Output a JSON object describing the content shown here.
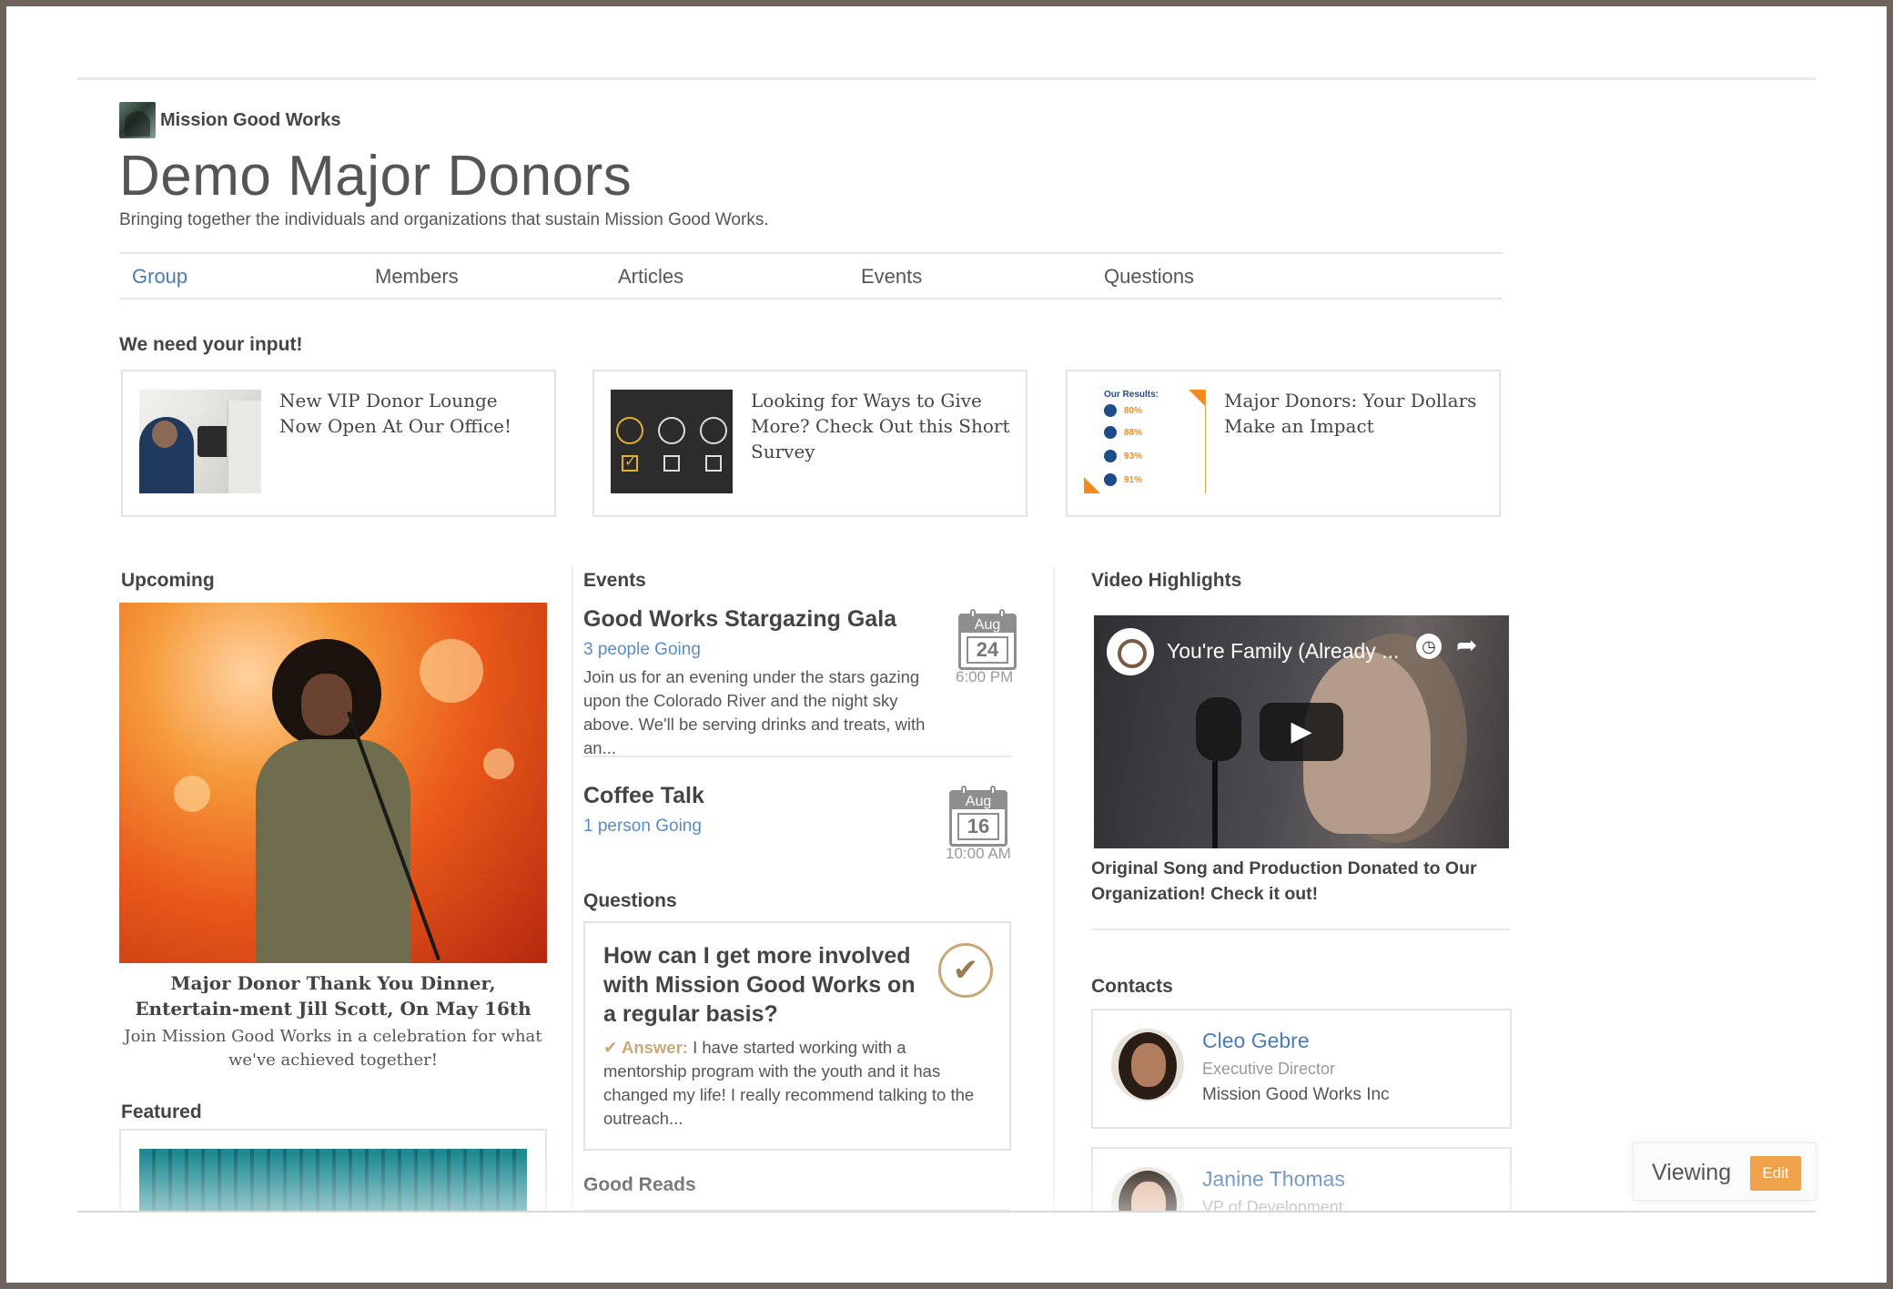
{
  "brand": {
    "name": "Mission Good Works"
  },
  "header": {
    "title": "Demo Major Donors",
    "subtitle": "Bringing together the individuals and organizations that sustain Mission Good Works."
  },
  "tabs": [
    {
      "label": "Group",
      "active": true
    },
    {
      "label": "Members",
      "active": false
    },
    {
      "label": "Articles",
      "active": false
    },
    {
      "label": "Events",
      "active": false
    },
    {
      "label": "Questions",
      "active": false
    }
  ],
  "input_section": {
    "heading": "We need your input!",
    "cards": [
      {
        "title": "New VIP Donor Lounge Now Open At Our Office!"
      },
      {
        "title": "Looking for Ways to Give More? Check Out this Short Survey"
      },
      {
        "title": "Major Donors: Your Dollars Make an Impact"
      }
    ],
    "infographic": {
      "heading": "Our Results:",
      "stats": [
        "80%",
        "88%",
        "93%",
        "91%"
      ]
    }
  },
  "upcoming": {
    "heading": "Upcoming",
    "caption": "Major Donor Thank You Dinner, Entertain-ment Jill Scott, On May 16th",
    "description": "Join Mission Good Works in a celebration for what we've achieved together!"
  },
  "featured": {
    "heading": "Featured"
  },
  "events": {
    "heading": "Events",
    "items": [
      {
        "title": "Good Works Stargazing Gala",
        "going": "3 people Going",
        "description": "Join us for an evening under the stars gazing upon the Colorado River and the night sky above. We'll be serving drinks and treats, with an...",
        "month": "Aug",
        "day": "24",
        "time": "6:00 PM"
      },
      {
        "title": "Coffee Talk",
        "going": "1 person Going",
        "description": "",
        "month": "Aug",
        "day": "16",
        "time": "10:00 AM"
      }
    ]
  },
  "questions": {
    "heading": "Questions",
    "item": {
      "title": "How can I get more involved with Mission Good Works on a regular basis?",
      "answer_label": "Answer:",
      "answer": "I have started working with a mentorship program with the youth and it has changed my life! I really recommend talking to the outreach..."
    }
  },
  "good_reads": {
    "heading": "Good Reads"
  },
  "video": {
    "heading": "Video Highlights",
    "title": "You're Family (Already ...",
    "caption": "Original Song and Production Donated to Our Organization! Check it out!"
  },
  "contacts": {
    "heading": "Contacts",
    "items": [
      {
        "name": "Cleo Gebre",
        "role": "Executive Director",
        "org": "Mission Good Works Inc"
      },
      {
        "name": "Janine Thomas",
        "role": "VP of Development",
        "org": ""
      }
    ]
  },
  "viewing": {
    "label": "Viewing",
    "edit_label": "Edit"
  },
  "colors": {
    "link": "#4a7bb5",
    "accent": "#f0a24a",
    "answer": "#c9a878"
  }
}
